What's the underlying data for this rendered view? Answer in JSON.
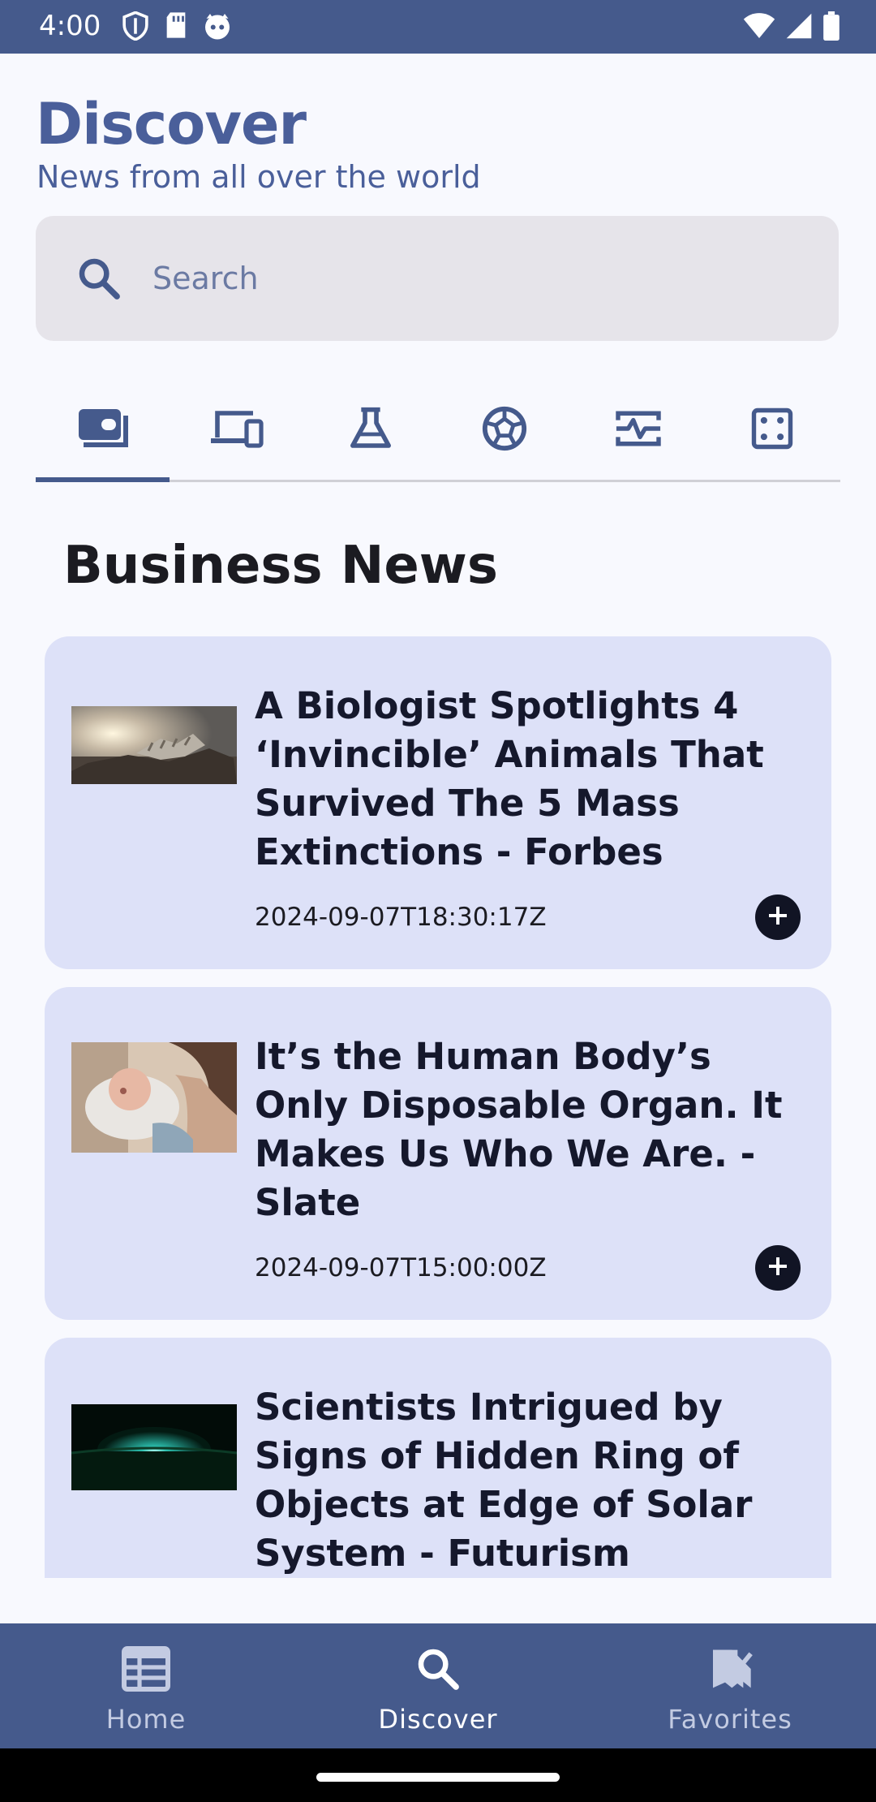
{
  "status_bar": {
    "time": "4:00",
    "left_icons": [
      "shield-icon",
      "sd-card-icon",
      "cat-icon"
    ],
    "right_icons": [
      "wifi-icon",
      "signal-icon",
      "battery-icon"
    ]
  },
  "header": {
    "title": "Discover",
    "subtitle": "News from all over the world"
  },
  "search": {
    "placeholder": "Search",
    "value": ""
  },
  "tabs": [
    {
      "icon": "business-icon",
      "active": true
    },
    {
      "icon": "devices-icon",
      "active": false
    },
    {
      "icon": "science-icon",
      "active": false
    },
    {
      "icon": "sports-icon",
      "active": false
    },
    {
      "icon": "health-icon",
      "active": false
    },
    {
      "icon": "entertainment-icon",
      "active": false
    }
  ],
  "section": {
    "title": "Business News"
  },
  "articles": [
    {
      "title": "A Biologist Spotlights 4 ‘Invincible’ Animals That Survived The 5 Mass Extinctions - Forbes",
      "date": "2024-09-07T18:30:17Z",
      "thumbnail": "skeleton-thumbnail"
    },
    {
      "title": "It’s the Human Body’s Only Disposable Organ. It Makes Us Who We Are. - Slate",
      "date": "2024-09-07T15:00:00Z",
      "thumbnail": "newborn-thumbnail"
    },
    {
      "title": "Scientists Intrigued by Signs of Hidden Ring of Objects at Edge of Solar System - Futurism",
      "date": "",
      "thumbnail": "space-thumbnail"
    }
  ],
  "bottom_nav": [
    {
      "label": "Home",
      "icon": "newspaper-icon",
      "active": false
    },
    {
      "label": "Discover",
      "icon": "search-icon",
      "active": true
    },
    {
      "label": "Favorites",
      "icon": "bookmark-check-icon",
      "active": false
    }
  ],
  "colors": {
    "primary": "#455a8c",
    "card_background": "#dde1f8",
    "page_background": "#f8f9fe",
    "search_background": "#e6e4ea"
  }
}
